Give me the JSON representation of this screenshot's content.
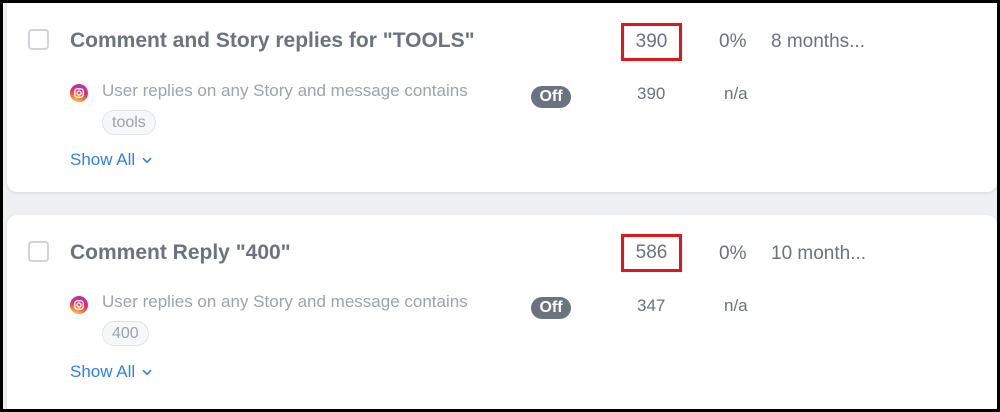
{
  "rules": [
    {
      "title": "Comment and Story replies for \"TOOLS\"",
      "count": "390",
      "percent": "0%",
      "modified": "8 months...",
      "trigger": {
        "platform_icon": "instagram-icon",
        "text": "User replies on any Story and message contains",
        "keyword": "tools",
        "status": "Off",
        "count": "390",
        "percent": "n/a"
      },
      "show_all_label": "Show All"
    },
    {
      "title": "Comment Reply \"400\"",
      "count": "586",
      "percent": "0%",
      "modified": "10 month...",
      "trigger": {
        "platform_icon": "instagram-icon",
        "text": "User replies on any Story and message contains",
        "keyword": "400",
        "status": "Off",
        "count": "347",
        "percent": "n/a"
      },
      "show_all_label": "Show All"
    }
  ],
  "colors": {
    "highlight_box": "#e3141d",
    "link": "#2f80ed",
    "status_off": "#6b7280"
  }
}
